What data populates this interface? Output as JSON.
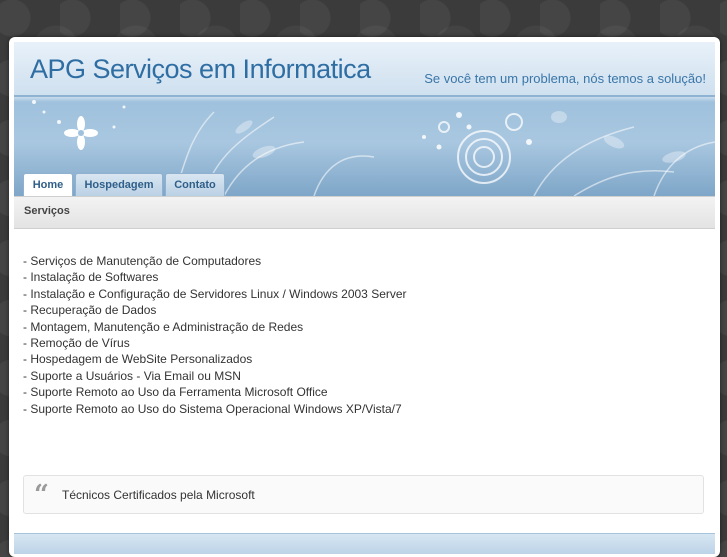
{
  "header": {
    "site_title": "APG Serviços em Informatica",
    "tagline": "Se você tem um problema, nós temos a solução!"
  },
  "nav": {
    "tabs": [
      {
        "label": "Home",
        "active": true
      },
      {
        "label": "Hospedagem",
        "active": false
      },
      {
        "label": "Contato",
        "active": false
      }
    ]
  },
  "section": {
    "title": "Serviços"
  },
  "services": [
    "- Serviços de Manutenção de Computadores",
    "- Instalação de Softwares",
    "- Instalação e Configuração de Servidores Linux / Windows 2003 Server",
    "- Recuperação de Dados",
    "- Montagem, Manutenção e Administração de Redes",
    "- Remoção de Vírus",
    "- Hospedagem de WebSite Personalizados",
    "- Suporte a Usuários - Via Email ou MSN",
    "- Suporte Remoto ao Uso da Ferramenta Microsoft Office",
    "- Suporte Remoto ao Uso do Sistema Operacional Windows XP/Vista/7"
  ],
  "quote": {
    "mark": "“",
    "text": "Técnicos Certificados pela Microsoft"
  },
  "colors": {
    "title": "#2f6ea3",
    "page_background": "#3b3b3b",
    "header_blue": "#9fc1dd"
  },
  "icons": {
    "quote_icon": "quote-icon"
  }
}
